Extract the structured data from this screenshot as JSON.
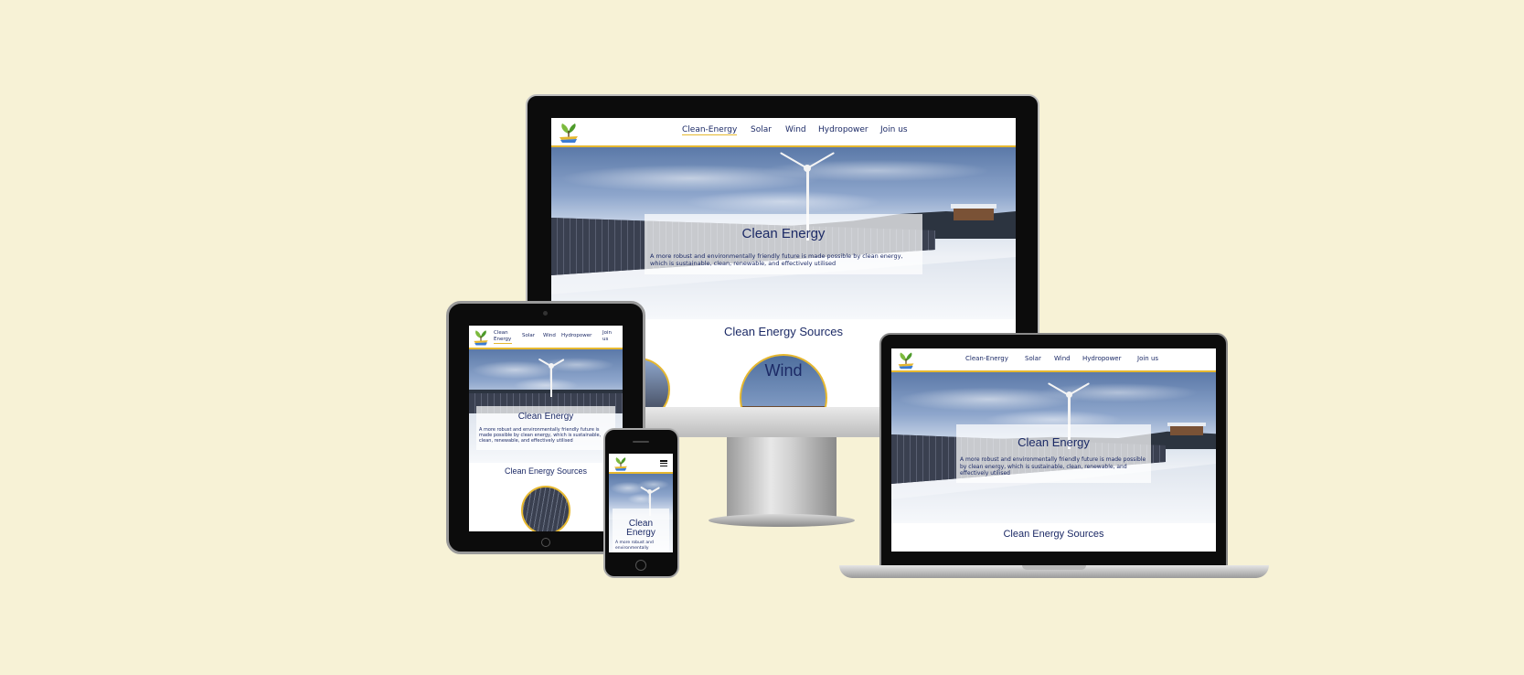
{
  "site": {
    "nav": {
      "links": [
        "Clean-Energy",
        "Solar",
        "Wind",
        "Hydropower",
        "Join us"
      ],
      "tablet_links": [
        "Clean Energy",
        "Solar",
        "Wind",
        "Hydropower",
        "Join us"
      ]
    },
    "hero": {
      "title": "Clean Energy",
      "text": "A more robust and environmentally friendly future is made possible by clean energy, which is sustainable, clean, renewable, and effectively utilised",
      "phone_text": "A more robust and environmentally"
    },
    "sections": {
      "sources_title": "Clean Energy Sources",
      "wind_label": "Wind"
    },
    "menu_icon": "hamburger-icon",
    "logo_icon": "leaf-logo-icon"
  },
  "colors": {
    "background": "#f7f2d6",
    "brand_navy": "#1c2a66",
    "accent_gold": "#e6b830"
  }
}
